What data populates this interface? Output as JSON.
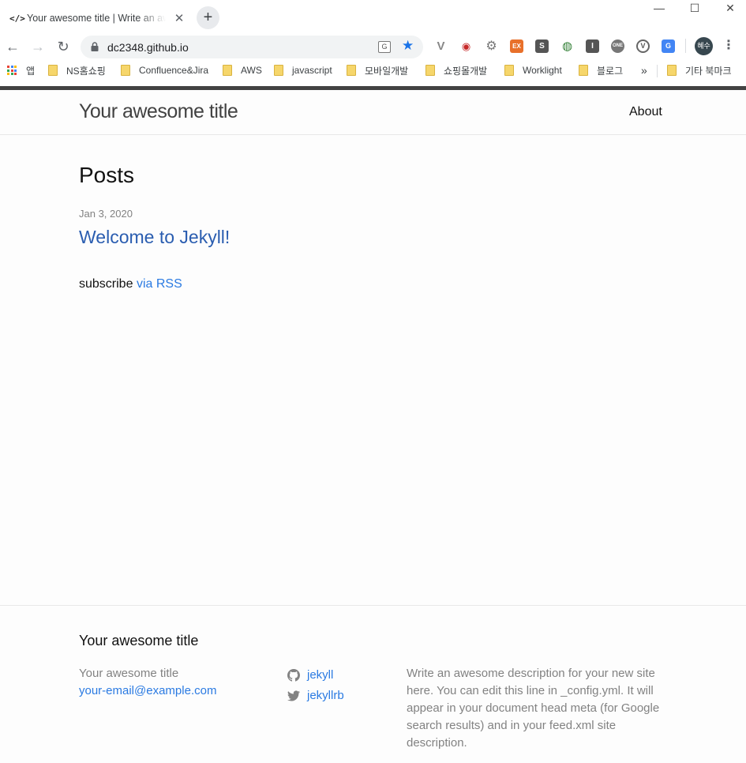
{
  "browser": {
    "tab": {
      "favicon": "</>",
      "title": "Your awesome title | Write an awesome description for your new site here.",
      "close": "✕"
    },
    "new_tab": "+",
    "window": {
      "minimize": "—",
      "maximize": "☐",
      "close": "✕"
    },
    "nav": {
      "back": "←",
      "forward": "→",
      "reload": "↻"
    },
    "url": "dc2348.github.io",
    "translate_chip": "G",
    "star": "★",
    "extensions": [
      "vue-devtools-icon",
      "privacy-badger-icon",
      "settings-gear-icon",
      "ex-icon",
      "s-icon",
      "globe-icon",
      "i-icon",
      "one-icon",
      "v-icon",
      "google-translate-icon"
    ],
    "profile": "혜수",
    "menu": "⋮",
    "bookmarks": {
      "apps": "앱",
      "items": [
        "NS홈쇼핑",
        "Confluence&Jira",
        "AWS",
        "javascript",
        "모바일개발",
        "쇼핑몰개발",
        "Worklight",
        "블로그"
      ],
      "overflow": "»",
      "other": "기타 북마크"
    }
  },
  "site": {
    "title": "Your awesome title",
    "nav": {
      "about": "About"
    }
  },
  "main": {
    "heading": "Posts",
    "posts": [
      {
        "date": "Jan 3, 2020",
        "title": "Welcome to Jekyll!"
      }
    ],
    "rss_prefix": "subscribe",
    "rss_link": "via RSS"
  },
  "footer": {
    "heading": "Your awesome title",
    "name": "Your awesome title",
    "email": "your-email@example.com",
    "github": "jekyll",
    "twitter": "jekyllrb",
    "description": "Write an awesome description for your new site here. You can edit this line in _config.yml. It will appear in your document head meta (for Google search results) and in your feed.xml site description."
  },
  "colors": {
    "link": "#2a7ae2",
    "post_link": "#2a5db0",
    "accent_bar": "#424242",
    "grey_text": "#828282"
  }
}
